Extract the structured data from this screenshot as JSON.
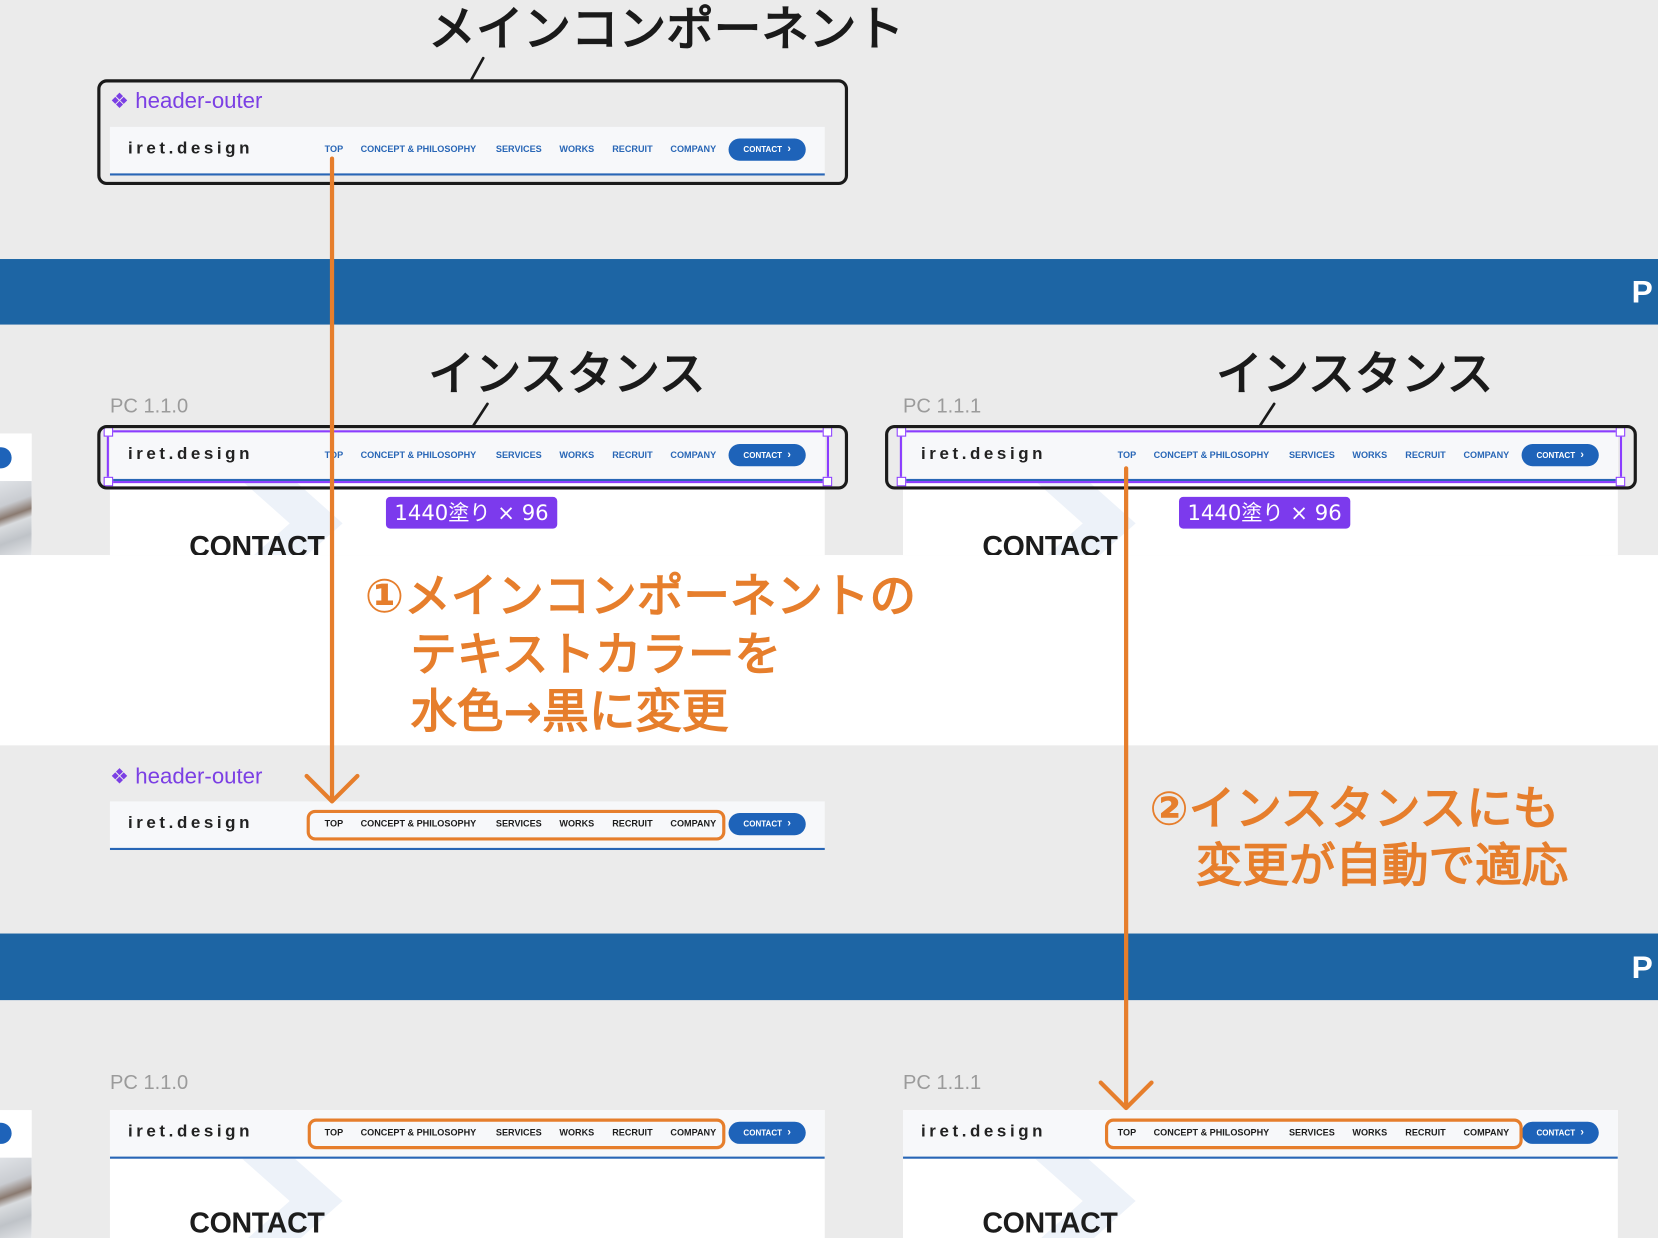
{
  "titles": {
    "main_component": "メインコンポーネント",
    "instance": "インスタンス"
  },
  "component": {
    "icon": "component-icon",
    "name": "header-outer"
  },
  "header": {
    "logo": "iret.design",
    "nav": [
      "TOP",
      "CONCEPT & PHILOSOPHY",
      "SERVICES",
      "WORKS",
      "RECRUIT",
      "COMPANY"
    ],
    "contact": "CONTACT",
    "contact_icon": "chevron-right-icon"
  },
  "frames": {
    "left": "PC 1.1.0",
    "right": "PC 1.1.1"
  },
  "size_badge": "1440塗り × 96",
  "section_heading": "CONTACT",
  "band_label": "P",
  "annotations": {
    "step1": [
      "①メインコンポーネントの",
      "テキストカラーを",
      "水色→黒に変更"
    ],
    "step2": [
      "②インスタンスにも",
      "変更が自動で適応"
    ]
  },
  "colors": {
    "canvas_gray": "#ebebeb",
    "band_blue": "#1d65a4",
    "nav_blue": "#2866b6",
    "nav_black": "#1c1c1c",
    "contact_blue": "#1e63b9",
    "component_purple": "#7b3fe4",
    "badge_purple": "#7c3aed",
    "selection_purple": "#8b3dff",
    "annotation_orange": "#e67e2c",
    "annotation_black": "#1a1a1a"
  }
}
